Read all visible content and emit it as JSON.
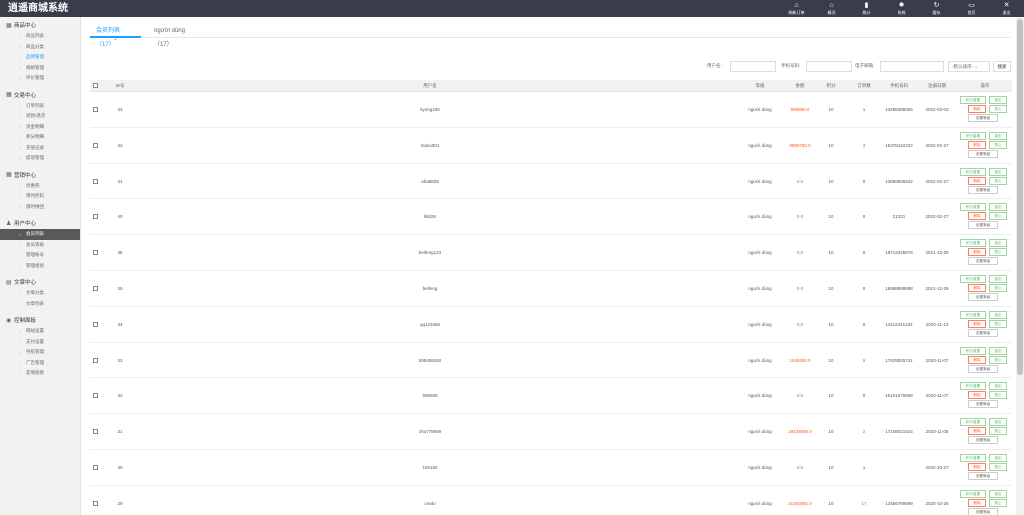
{
  "app": {
    "title": "逍遥商城系统"
  },
  "topnav": [
    {
      "label": "刷新订单",
      "icon": "home-icon"
    },
    {
      "label": "概况",
      "icon": "home-icon"
    },
    {
      "label": "统计",
      "icon": "bar-chart-icon"
    },
    {
      "label": "系统",
      "icon": "gear-icon"
    },
    {
      "label": "缓存",
      "icon": "refresh-icon"
    },
    {
      "label": "首页",
      "icon": "monitor-icon"
    },
    {
      "label": "退出",
      "icon": "close-icon"
    }
  ],
  "sidebar": {
    "groups": [
      {
        "title": "商品中心",
        "icon": "grid-icon",
        "items": [
          "商品列表",
          "商品分类",
          "品牌管理",
          "规格管理",
          "评价管理"
        ]
      },
      {
        "title": "交易中心",
        "icon": "grid-icon",
        "items": [
          "订单列表",
          "退款/退货",
          "资金明细",
          "积分明细",
          "充值记录",
          "提现管理"
        ]
      },
      {
        "title": "营销中心",
        "icon": "grid-icon",
        "items": [
          "优惠券",
          "限时折扣",
          "限时拼团"
        ]
      },
      {
        "title": "用户中心",
        "icon": "user-icon",
        "items": [
          "会员列表",
          "会员等级",
          "管理帐号",
          "管理组别"
        ]
      },
      {
        "title": "文章中心",
        "icon": "file-icon",
        "items": [
          "文章分类",
          "文章列表"
        ]
      },
      {
        "title": "控制面板",
        "icon": "dashboard-icon",
        "items": [
          "网站设置",
          "支付设置",
          "导航管理",
          "广告管理",
          "友情链接"
        ]
      }
    ]
  },
  "tabs": [
    "会员列表（17）",
    "người dùng（17）"
  ],
  "filters": {
    "username_label": "用户名:",
    "phone_label": "手机号码:",
    "email_label": "电子邮箱:",
    "select_value": "-默认排序-",
    "search_label": "搜索"
  },
  "table": {
    "headers": [
      "ID号",
      "用户名",
      "等级",
      "余额",
      "积分",
      "订单数",
      "手机号码",
      "注册日期",
      "操作"
    ],
    "rows": [
      {
        "id": "43",
        "username": "liyong180",
        "level": "người dùng",
        "balance": "999990.0",
        "points": "10",
        "orders": "1",
        "phone": "13288388365",
        "date": "2022-03-03"
      },
      {
        "id": "42",
        "username": "mario001",
        "level": "người dùng",
        "balance": "9980750.0",
        "points": "10",
        "orders": "3",
        "phone": "15378442222",
        "date": "2022-02-27"
      },
      {
        "id": "41",
        "username": "aha8828",
        "level": "người dùng",
        "balance": "0.0",
        "points": "10",
        "orders": "0",
        "phone": "13888555522",
        "date": "2022-02-27"
      },
      {
        "id": "40",
        "username": "lkl828",
        "level": "người dùng",
        "balance": "0.0",
        "points": "10",
        "orders": "0",
        "phone": "21321",
        "date": "2022-02-27"
      },
      {
        "id": "36",
        "username": "beifeng123",
        "level": "người dùng",
        "balance": "0.0",
        "points": "10",
        "orders": "0",
        "phone": "18712345678",
        "date": "2021-12-29"
      },
      {
        "id": "35",
        "username": "beifeng",
        "level": "người dùng",
        "balance": "0.0",
        "points": "10",
        "orders": "0",
        "phone": "18888888888",
        "date": "2021-12-29"
      },
      {
        "id": "34",
        "username": "qq123456",
        "level": "người dùng",
        "balance": "0.0",
        "points": "10",
        "orders": "0",
        "phone": "13112341234",
        "date": "2020-11-13"
      },
      {
        "id": "33",
        "username": "595458492",
        "level": "người dùng",
        "balance": "1198450.0",
        "points": "10",
        "orders": "9",
        "phone": "17629025741",
        "date": "2020-11-07"
      },
      {
        "id": "32",
        "username": "595958",
        "level": "người dùng",
        "balance": "0.0",
        "points": "10",
        "orders": "0",
        "phone": "15101578669",
        "date": "2020-11-07"
      },
      {
        "id": "31",
        "username": "zhu778899",
        "level": "người dùng",
        "balance": "19435690.0",
        "points": "10",
        "orders": "2",
        "phone": "17108021524",
        "date": "2020-11-05"
      },
      {
        "id": "30",
        "username": "150150",
        "level": "người dùng",
        "balance": "0.0",
        "points": "10",
        "orders": "1",
        "phone": "",
        "date": "2020-10-27"
      },
      {
        "id": "29",
        "username": "credo",
        "level": "người dùng",
        "balance": "31463691.0",
        "points": "10",
        "orders": "17",
        "phone": "13456789999",
        "date": "2020-10-26"
      }
    ],
    "actions": {
      "reset": "积分重置",
      "lock": "锁定",
      "delete": "删除",
      "forbid": "禁止",
      "set_level": "设置等级"
    }
  },
  "colors": {
    "topbar": "#393d49",
    "accent": "#1e9fff",
    "orange": "#ff5722",
    "green": "#5fb878",
    "active_nav": "#595959"
  }
}
